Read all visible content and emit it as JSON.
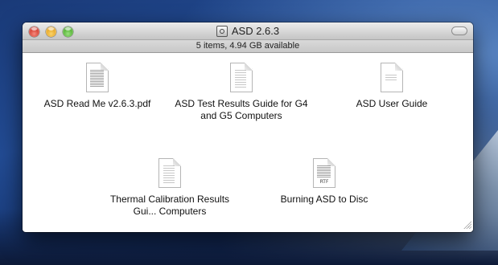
{
  "window": {
    "title": "ASD 2.6.3",
    "disk_icon": "disk-image-icon"
  },
  "status": {
    "text": "5 items, 4.94 GB available"
  },
  "items": [
    {
      "label": "ASD Read Me v2.6.3.pdf",
      "icon": "pdf-document-icon"
    },
    {
      "label": "ASD Test Results Guide for G4 and G5 Computers",
      "icon": "pdf-document-icon"
    },
    {
      "label": "ASD User Guide",
      "icon": "document-icon"
    },
    {
      "label": "Thermal Calibration Results Gui... Computers",
      "icon": "pdf-document-icon"
    },
    {
      "label": "Burning ASD to Disc",
      "icon": "rtf-document-icon",
      "tag": "RTF"
    }
  ],
  "colors": {
    "close": "#d23a2c",
    "minimize": "#e5a523",
    "zoom": "#4faf2d"
  }
}
